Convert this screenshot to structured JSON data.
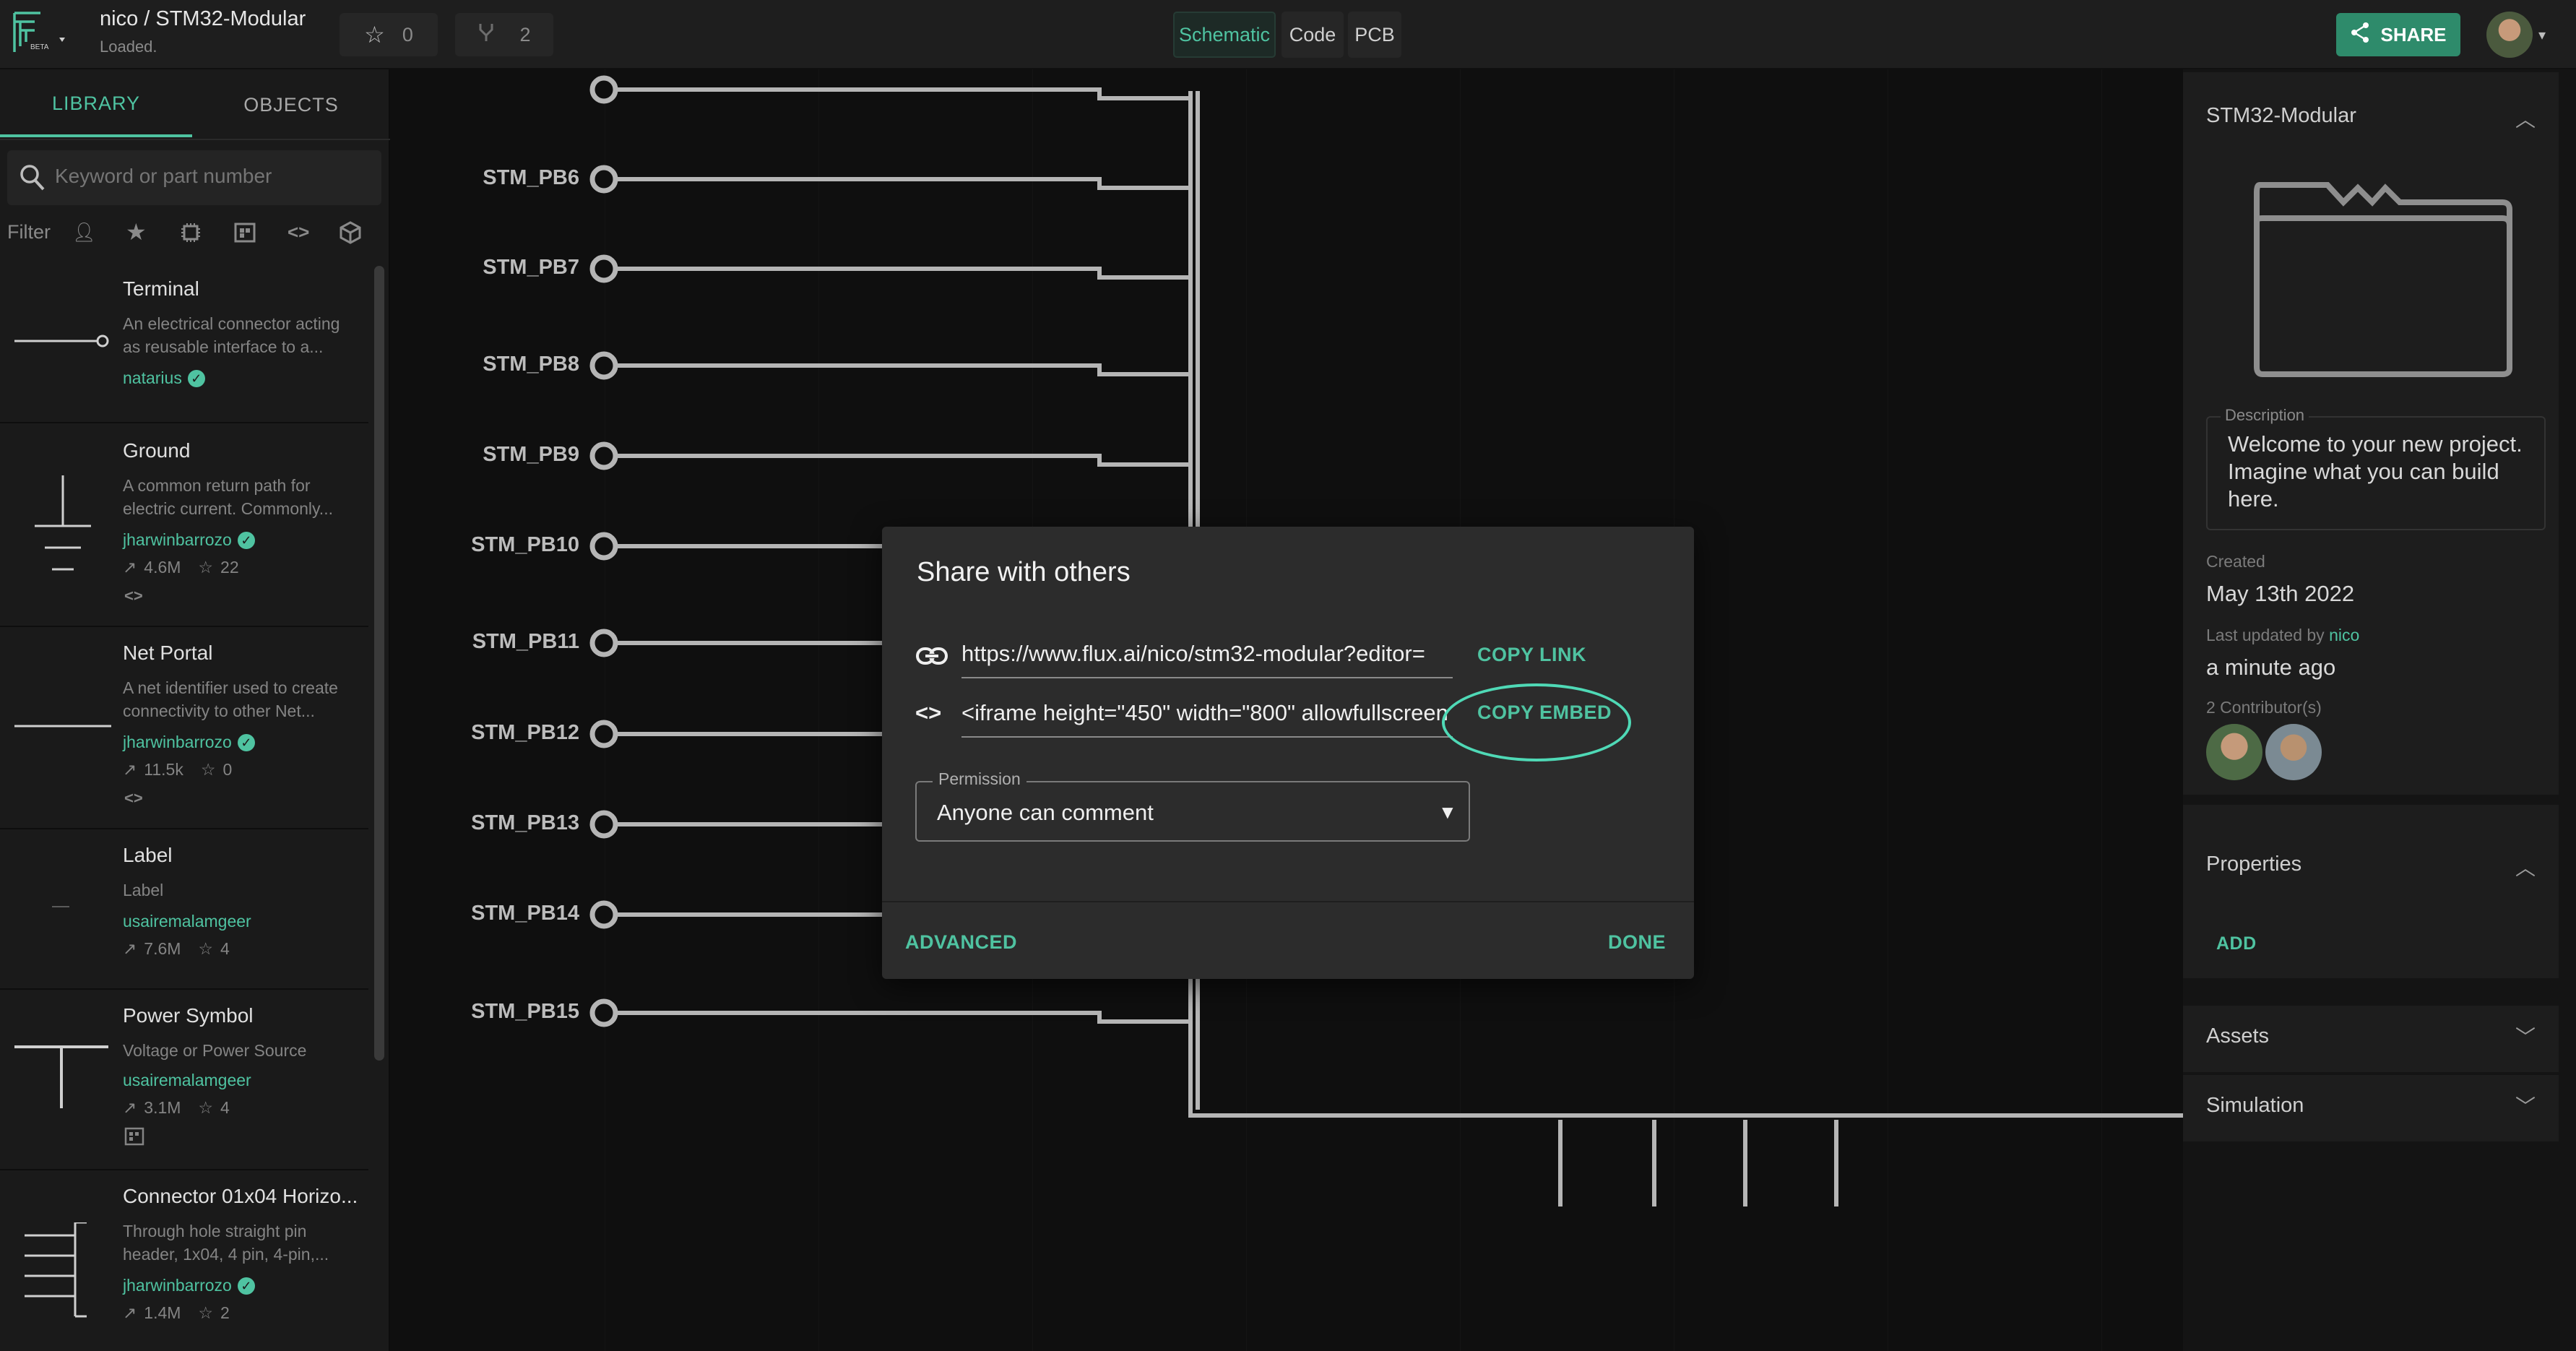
{
  "topbar": {
    "beta_label": "BETA",
    "project_path": "nico / STM32-Modular",
    "status": "Loaded.",
    "star_count": "0",
    "fork_count": "2",
    "tabs": [
      "Schematic",
      "Code",
      "PCB"
    ],
    "share_label": "SHARE"
  },
  "library": {
    "tabs": [
      "LIBRARY",
      "OBJECTS"
    ],
    "search_placeholder": "Keyword or part number",
    "filter_label": "Filter",
    "items": [
      {
        "title": "Terminal",
        "desc": "An electrical connector acting as reusable interface to a...",
        "author": "natarius"
      },
      {
        "title": "Ground",
        "desc": "A common return path for electric current. Commonly...",
        "author": "jharwinbarrozo",
        "uses": "4.6M",
        "stars": "22"
      },
      {
        "title": "Net Portal",
        "desc": "A net identifier used to create connectivity to other Net...",
        "author": "jharwinbarrozo",
        "uses": "11.5k",
        "stars": "0"
      },
      {
        "title": "Label",
        "desc": "Label",
        "author": "usairemalamgeer",
        "uses": "7.6M",
        "stars": "4"
      },
      {
        "title": "Power Symbol",
        "desc": "Voltage or Power Source",
        "author": "usairemalamgeer",
        "uses": "3.1M",
        "stars": "4"
      },
      {
        "title": "Connector 01x04 Horizo...",
        "desc": "Through hole straight pin header, 1x04, 4 pin, 4-pin,...",
        "author": "jharwinbarrozo",
        "uses": "1.4M",
        "stars": "2"
      }
    ]
  },
  "schematic": {
    "pins": [
      "STM_PB6",
      "STM_PB7",
      "STM_PB8",
      "STM_PB9",
      "STM_PB10",
      "STM_PB11",
      "STM_PB12",
      "STM_PB13",
      "STM_PB14",
      "STM_PB15"
    ]
  },
  "modal": {
    "title": "Share with others",
    "link_value": "https://www.flux.ai/nico/stm32-modular?editor=",
    "copy_link": "COPY LINK",
    "embed_value": "<iframe height=\"450\" width=\"800\" allowfullscreen",
    "copy_embed": "COPY EMBED",
    "permission_label": "Permission",
    "permission_value": "Anyone can comment",
    "advanced": "ADVANCED",
    "done": "DONE"
  },
  "rightpanel": {
    "project_name": "STM32-Modular",
    "description_label": "Description",
    "description": "Welcome to your new project. Imagine what you can build here.",
    "created_label": "Created",
    "created_value": "May 13th 2022",
    "updated_label": "Last updated by",
    "updated_by": "nico",
    "updated_value": "a minute ago",
    "contributors": "2 Contributor(s)",
    "properties": "Properties",
    "add": "ADD",
    "assets": "Assets",
    "simulation": "Simulation"
  },
  "colors": {
    "accent": "#4fc3a1",
    "share_button": "#2e8b6b",
    "highlight": "#4fd9b6"
  }
}
